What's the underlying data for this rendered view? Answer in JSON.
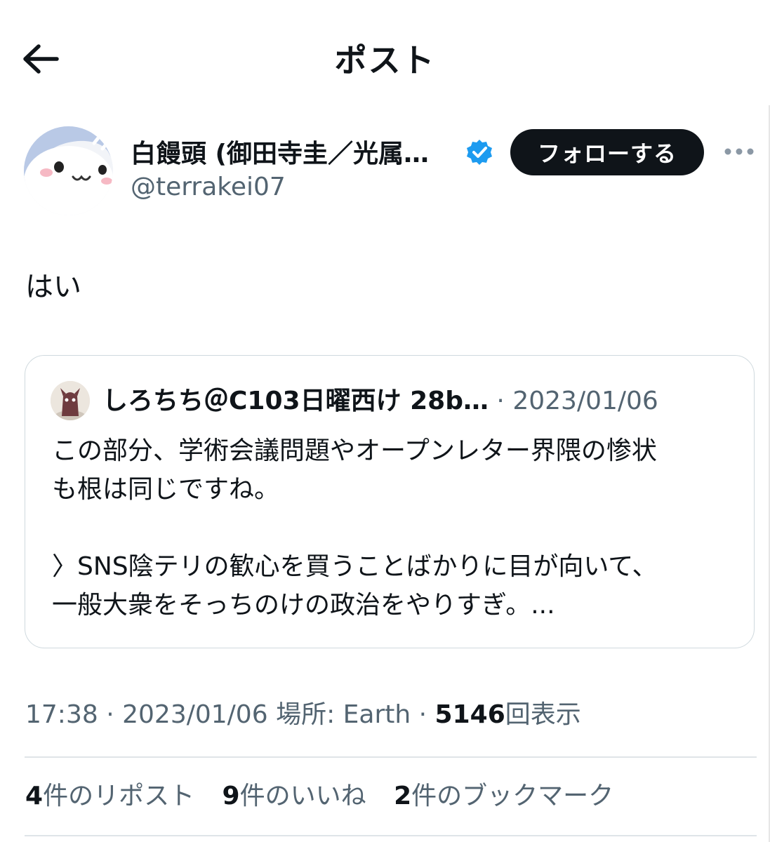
{
  "header": {
    "title": "ポスト",
    "back_icon": "arrow-left-icon"
  },
  "post": {
    "author": {
      "name": "白饅頭 (御田寺圭／光属…",
      "handle": "@terrakei07",
      "verified": true
    },
    "follow_label": "フォローする",
    "more_icon": "more-horizontal-icon",
    "text": "はい"
  },
  "quote": {
    "author_name": "しろちち＠C103日曜西け 28b…",
    "separator": "·",
    "date": "2023/01/06",
    "lines": [
      "この部分、学術会議問題やオープンレター界隈の惨状",
      "も根は同じですね。",
      "",
      "〉SNS陰テリの歓心を買うことばかりに目が向いて、",
      "一般大衆をそっちのけの政治をやりすぎ。..."
    ]
  },
  "meta": {
    "time": "17:38",
    "sep1": "·",
    "date": "2023/01/06",
    "location": "場所: Earth",
    "sep2": "·",
    "views": "5146",
    "views_label": "回表示"
  },
  "stats": [
    {
      "count": "4",
      "label": "件のリポスト"
    },
    {
      "count": "9",
      "label": "件のいいね"
    },
    {
      "count": "2",
      "label": "件のブックマーク"
    }
  ],
  "colors": {
    "text": "#0f1419",
    "secondary": "#536471",
    "verified": "#1d9bf0",
    "border": "#cfd9de"
  }
}
